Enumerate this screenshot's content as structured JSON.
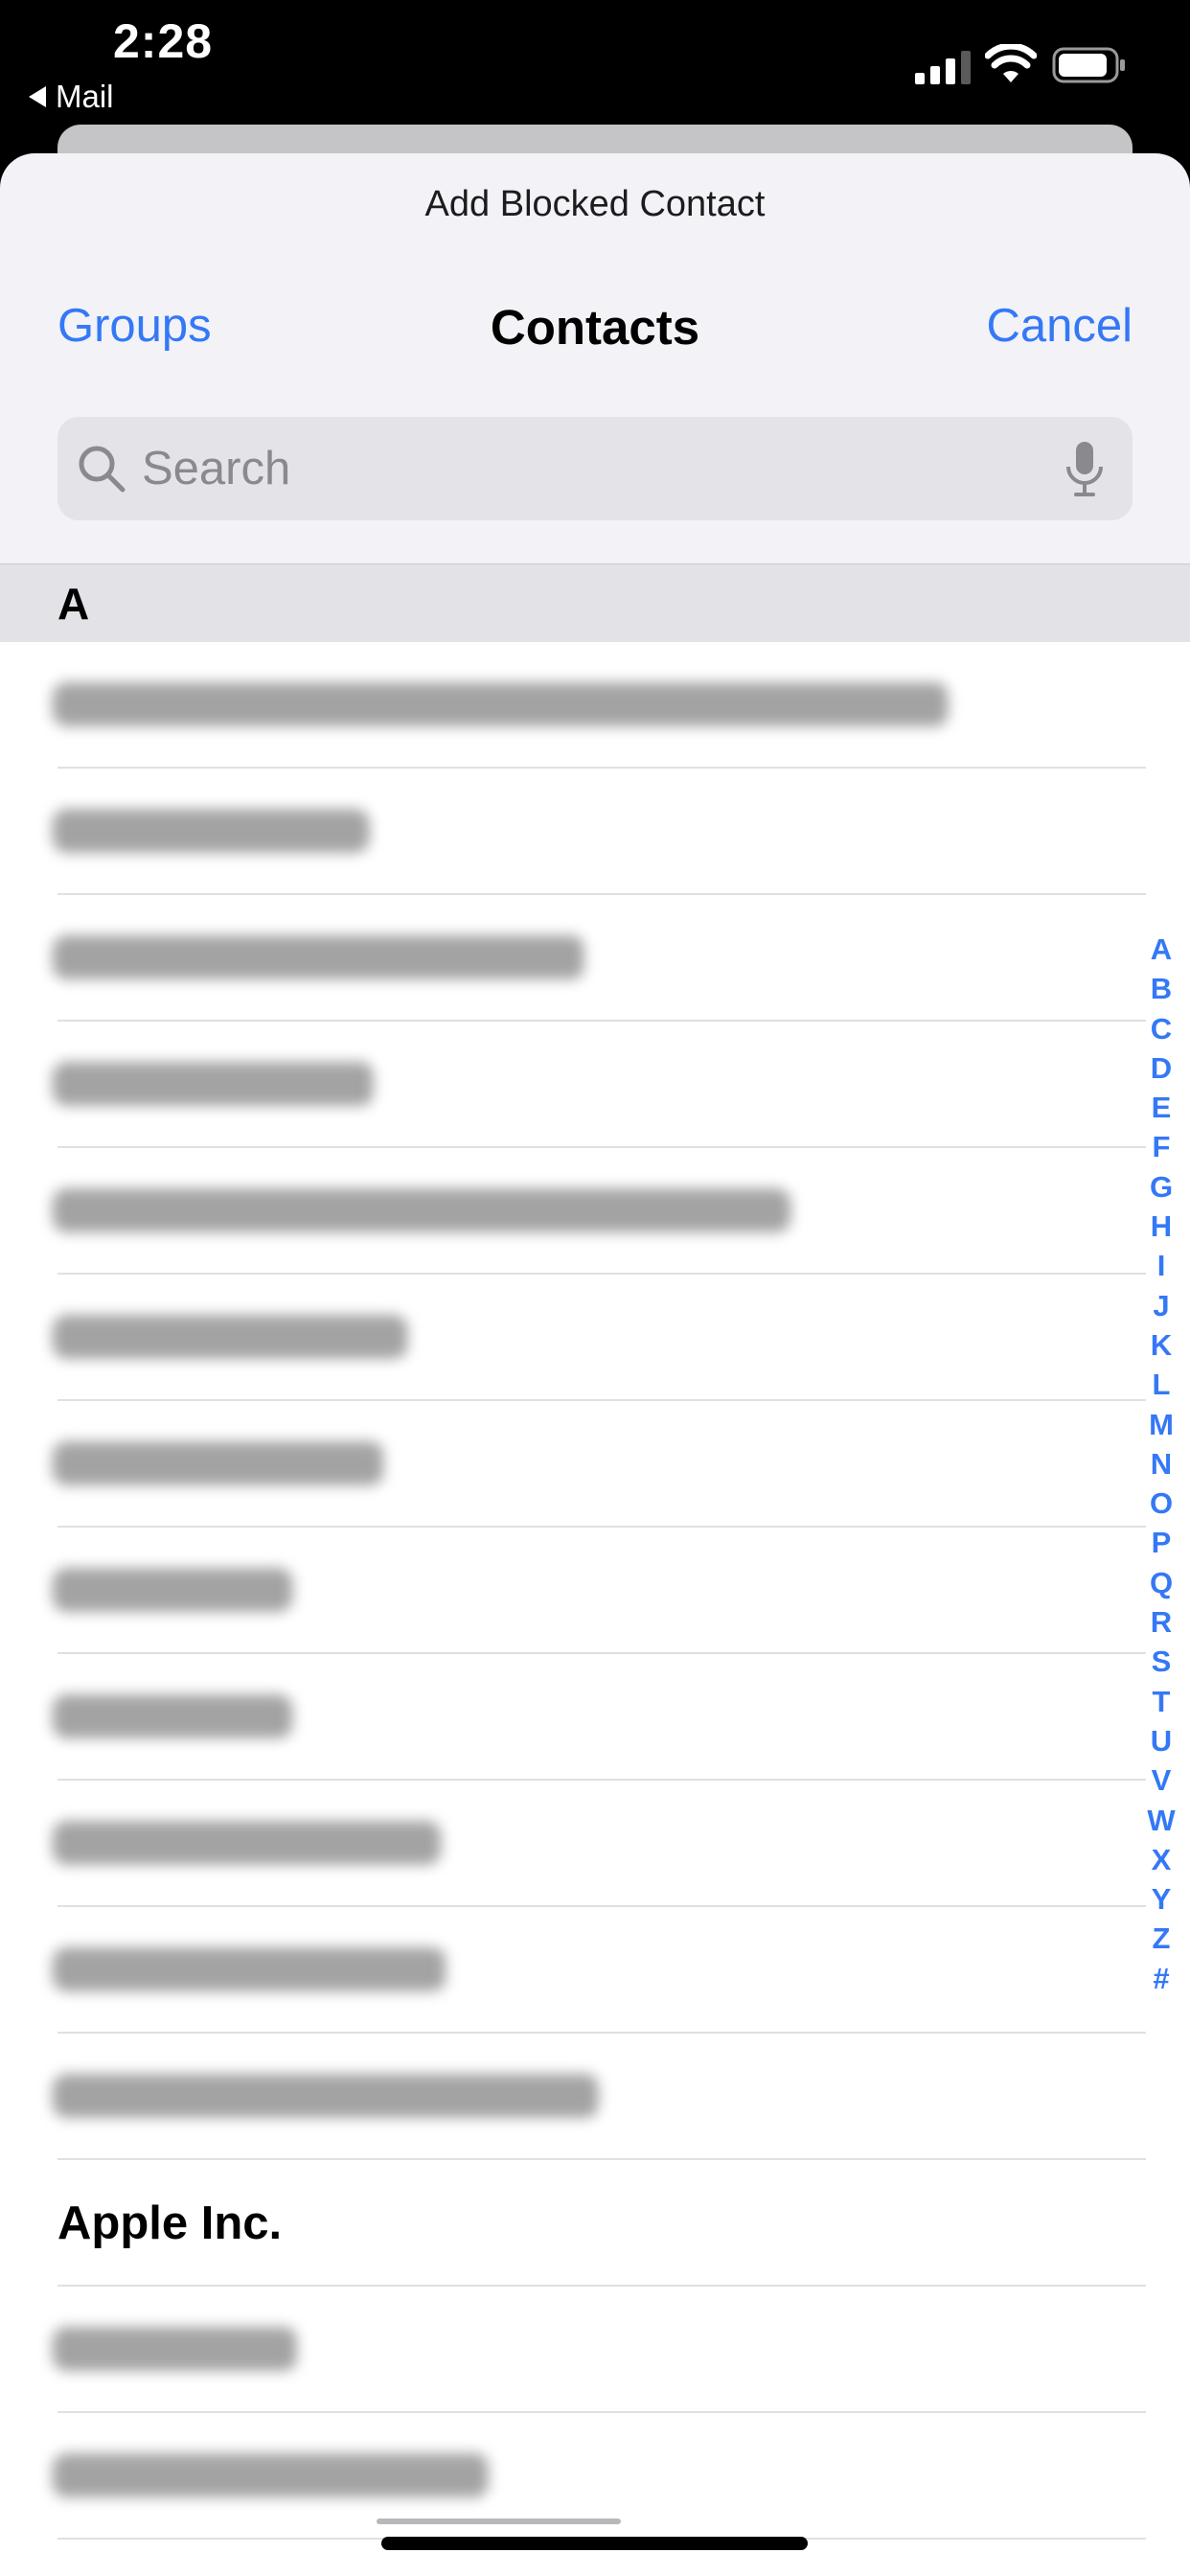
{
  "status_bar": {
    "time": "2:28",
    "back_app": "Mail",
    "signal_icon": "cellular-signal-icon",
    "wifi_icon": "wifi-icon",
    "battery_icon": "battery-icon"
  },
  "sheet": {
    "prompt": "Add Blocked Contact",
    "nav": {
      "left": "Groups",
      "title": "Contacts",
      "right": "Cancel"
    }
  },
  "search": {
    "placeholder": "Search",
    "value": "",
    "icon": "search-icon",
    "mic_icon": "microphone-icon"
  },
  "section": {
    "letter": "A"
  },
  "contacts": [
    {
      "label": "",
      "blurred": true
    },
    {
      "label": "",
      "blurred": true
    },
    {
      "label": "",
      "blurred": true
    },
    {
      "label": "",
      "blurred": true
    },
    {
      "label": "",
      "blurred": true
    },
    {
      "label": "",
      "blurred": true
    },
    {
      "label": "",
      "blurred": true
    },
    {
      "label": "",
      "blurred": true
    },
    {
      "label": "",
      "blurred": true
    },
    {
      "label": "",
      "blurred": true
    },
    {
      "label": "",
      "blurred": true
    },
    {
      "label": "",
      "blurred": true
    },
    {
      "label": "Apple Inc.",
      "blurred": false
    },
    {
      "label": "",
      "blurred": true
    },
    {
      "label": "",
      "blurred": true
    }
  ],
  "index_letters": [
    "A",
    "B",
    "C",
    "D",
    "E",
    "F",
    "G",
    "H",
    "I",
    "J",
    "K",
    "L",
    "M",
    "N",
    "O",
    "P",
    "Q",
    "R",
    "S",
    "T",
    "U",
    "V",
    "W",
    "X",
    "Y",
    "Z",
    "#"
  ],
  "colors": {
    "accent": "#3478f6",
    "sheet_bg": "#f2f2f7",
    "section_bg": "#e3e3e7"
  }
}
